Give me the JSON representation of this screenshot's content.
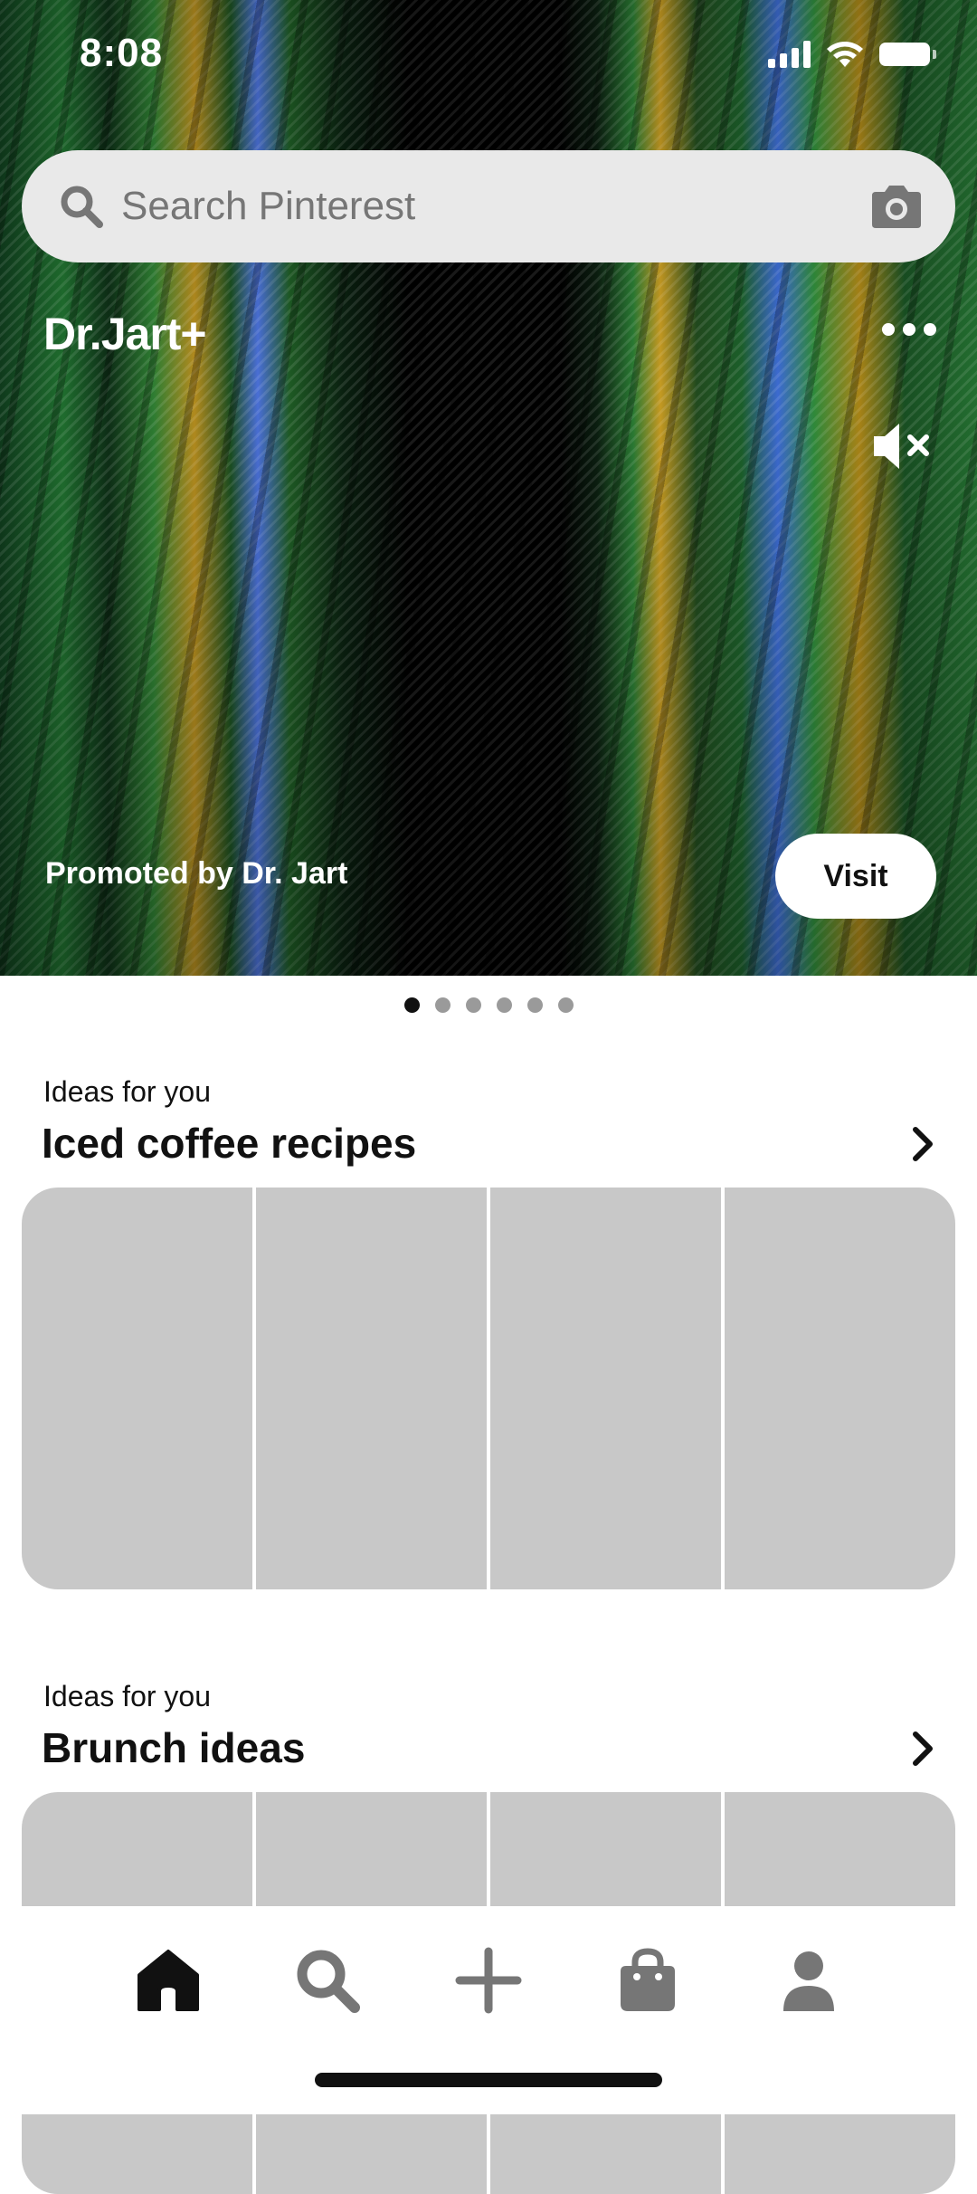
{
  "status_bar": {
    "time": "8:08"
  },
  "search": {
    "placeholder": "Search Pinterest"
  },
  "promo": {
    "brand": "Dr.Jart+",
    "promoted_text": "Promoted by Dr. Jart",
    "visit_label": "Visit",
    "carousel_count": 6,
    "carousel_active": 1
  },
  "sections": [
    {
      "subtitle": "Ideas for you",
      "title": "Iced coffee recipes"
    },
    {
      "subtitle": "Ideas for you",
      "title": "Brunch ideas"
    }
  ],
  "nav": {
    "items": [
      "home-icon",
      "search-icon",
      "plus-icon",
      "shopping-bag-icon",
      "profile-icon"
    ],
    "active": "home-icon"
  },
  "colors": {
    "search_bg": "#e9e9e9",
    "tile_placeholder": "#c8c8c8",
    "text": "#111111",
    "placeholder_text": "#767676"
  }
}
